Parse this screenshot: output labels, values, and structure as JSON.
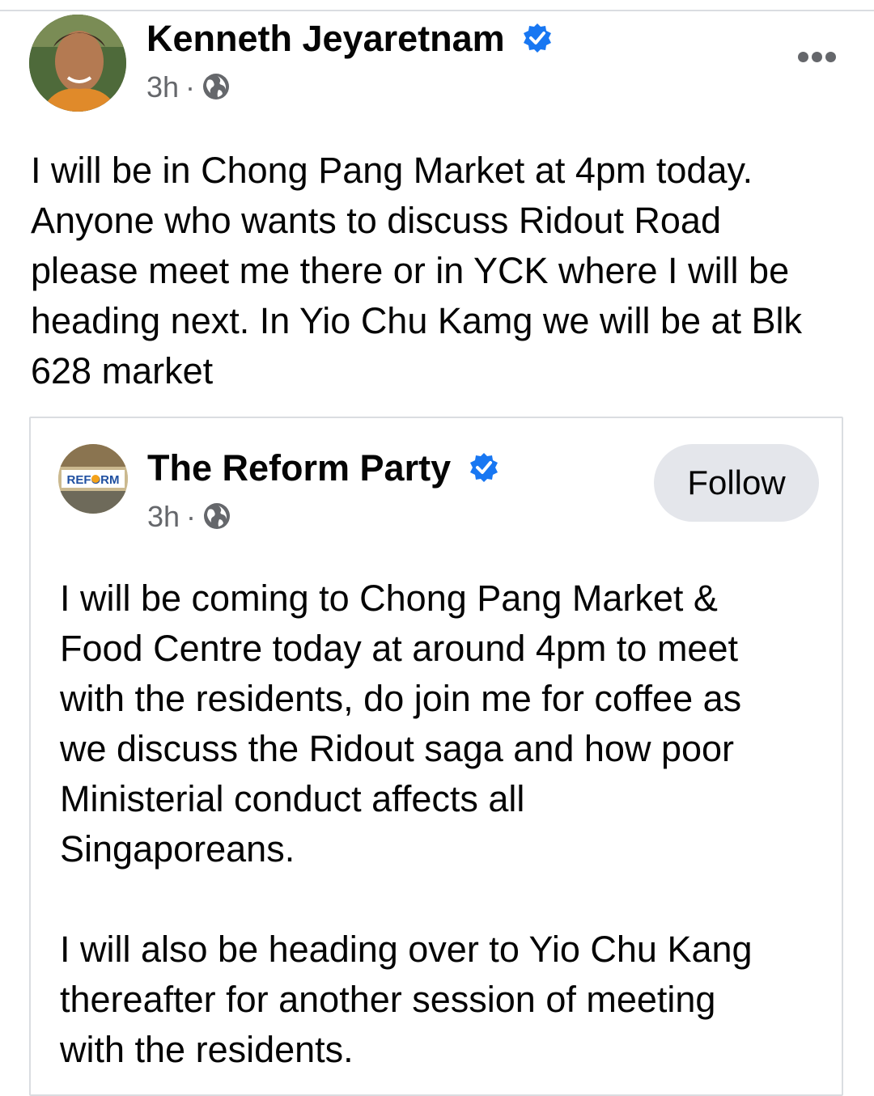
{
  "post": {
    "author": "Kenneth Jeyaretnam",
    "time": "3h",
    "separator": "·",
    "body": "I will be in Chong Pang Market at 4pm today.\nAnyone who wants to discuss Ridout Road\nplease meet me there or in YCK where I will be\nheading next. In Yio Chu Kamg we will be at Blk\n628 market"
  },
  "shared": {
    "page_name": "The Reform Party",
    "time": "3h",
    "separator": "·",
    "follow_label": "Follow",
    "logo_text": "REFORM",
    "body": "I will be coming to Chong Pang Market &\nFood Centre today at around 4pm to meet\nwith the residents, do join me for coffee as\nwe discuss the Ridout saga and how poor\nMinisterial conduct affects all\nSingaporeans.\n\nI will also be heading over to Yio Chu Kang\nthereafter for another session of meeting\nwith the residents."
  },
  "colors": {
    "verified": "#1877f2",
    "secondary_text": "#65676b",
    "button_bg": "#e4e6eb",
    "divider": "#dadde1"
  },
  "icons": [
    "verified-badge-icon",
    "globe-icon",
    "more-options-icon"
  ]
}
